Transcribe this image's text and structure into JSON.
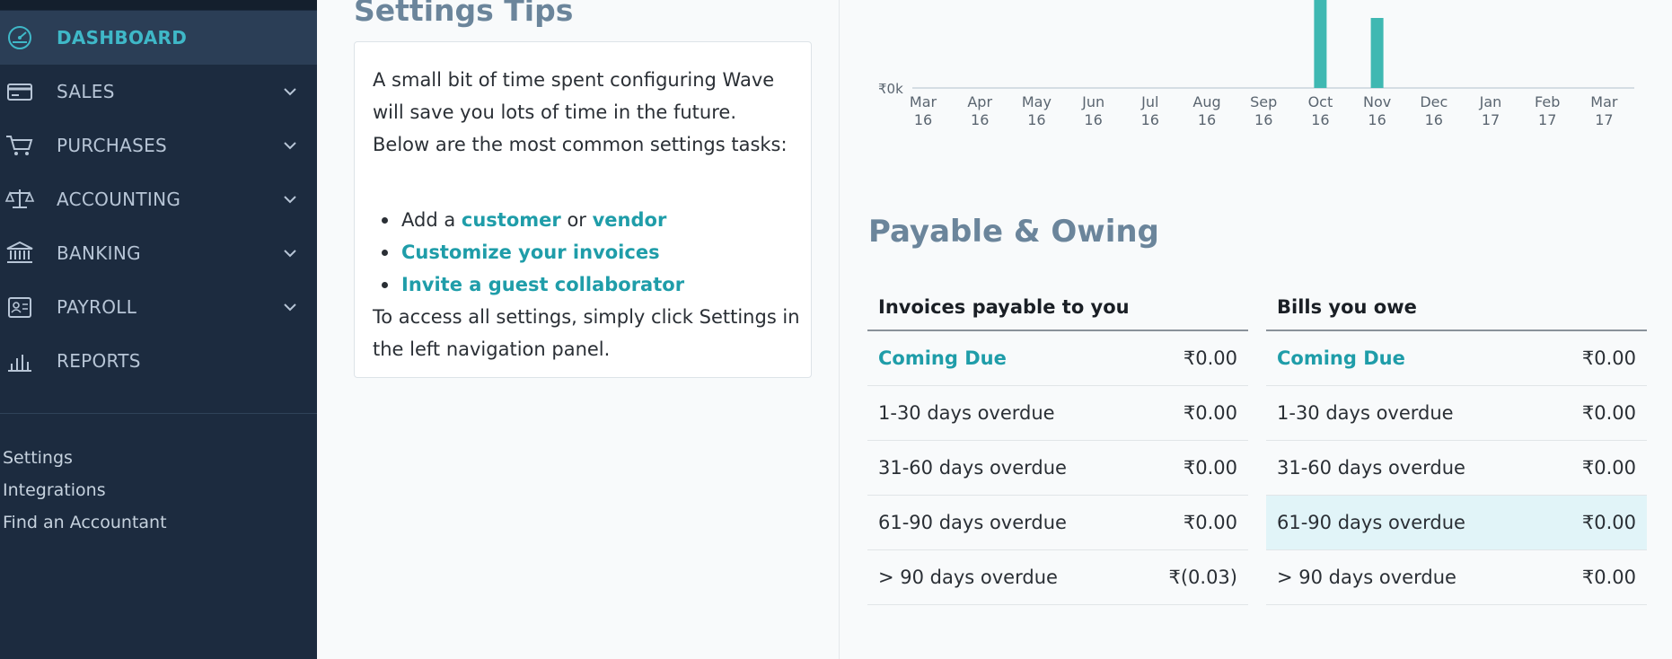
{
  "sidebar": {
    "items": [
      {
        "label": "DASHBOARD",
        "icon": "speedometer-icon",
        "active": true
      },
      {
        "label": "SALES",
        "icon": "credit-card-icon"
      },
      {
        "label": "PURCHASES",
        "icon": "cart-icon"
      },
      {
        "label": "ACCOUNTING",
        "icon": "scales-icon"
      },
      {
        "label": "BANKING",
        "icon": "bank-icon"
      },
      {
        "label": "PAYROLL",
        "icon": "id-badge-icon"
      },
      {
        "label": "REPORTS",
        "icon": "bar-chart-icon"
      }
    ],
    "links": [
      "Settings",
      "Integrations",
      "Find an Accountant"
    ],
    "colors": {
      "background": "#1c2b3f",
      "active": "#2b3e56",
      "accent": "#3fb8c8"
    }
  },
  "settings_tips": {
    "title": "Settings Tips",
    "intro_lines": [
      "A small bit of time spent configuring Wave",
      "will save you lots of time in the future.",
      "Below are the most common settings tasks:"
    ],
    "list": {
      "add_prefix": "Add a",
      "customer": "customer",
      "or": "or",
      "vendor": "vendor",
      "customize": "Customize your invoices",
      "invite": "Invite a guest collaborator"
    },
    "outro_lines": [
      "To access all settings, simply click Settings in",
      "the left navigation panel."
    ]
  },
  "chart_data": {
    "type": "bar",
    "ylabel_tick": "₹0k",
    "categories": [
      "Mar\n16",
      "Apr\n16",
      "May\n16",
      "Jun\n16",
      "Jul\n16",
      "Aug\n16",
      "Sep\n16",
      "Oct\n16",
      "Nov\n16",
      "Dec\n16",
      "Jan\n17",
      "Feb\n17",
      "Mar\n17"
    ],
    "values": [
      0,
      0,
      0,
      0,
      0,
      0,
      0,
      1.0,
      0.78,
      0,
      0,
      0,
      0
    ],
    "bar_color": "#3fb8b2"
  },
  "payable": {
    "title": "Payable & Owing",
    "invoices": {
      "header": "Invoices payable to you",
      "rows": [
        {
          "label": "Coming Due",
          "amount": "₹0.00",
          "link": true
        },
        {
          "label": "1-30 days overdue",
          "amount": "₹0.00"
        },
        {
          "label": "31-60 days overdue",
          "amount": "₹0.00"
        },
        {
          "label": "61-90 days overdue",
          "amount": "₹0.00"
        },
        {
          "label": "> 90 days overdue",
          "amount": "₹(0.03)"
        }
      ]
    },
    "bills": {
      "header": "Bills you owe",
      "rows": [
        {
          "label": "Coming Due",
          "amount": "₹0.00",
          "link": true
        },
        {
          "label": "1-30 days overdue",
          "amount": "₹0.00"
        },
        {
          "label": "31-60 days overdue",
          "amount": "₹0.00"
        },
        {
          "label": "61-90 days overdue",
          "amount": "₹0.00",
          "highlight": true
        },
        {
          "label": "> 90 days overdue",
          "amount": "₹0.00"
        }
      ]
    }
  }
}
